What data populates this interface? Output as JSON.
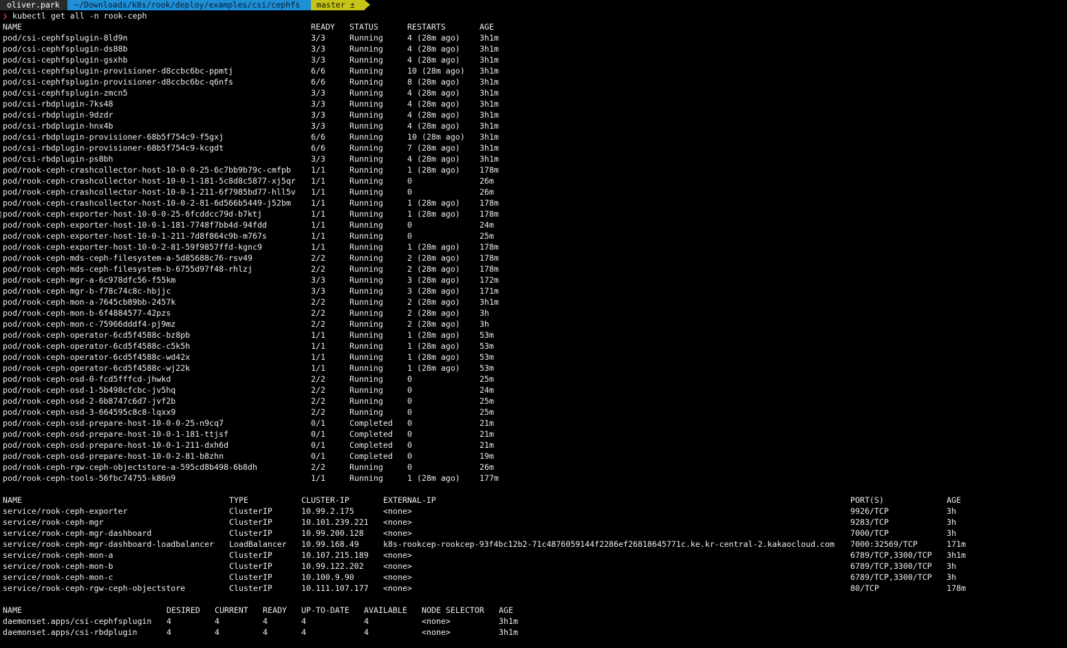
{
  "prompt": {
    "user": "oliver.park",
    "path": "~/Downloads/k8s/rook/deploy/examples/csi/cephfs",
    "git_branch": "master ±",
    "chevron": "❯",
    "command": "kubectl get all -n rook-ceph"
  },
  "pods": {
    "headers": [
      "NAME",
      "READY",
      "STATUS",
      "RESTARTS",
      "AGE"
    ],
    "rows": [
      [
        "pod/csi-cephfsplugin-8ld9n",
        "3/3",
        "Running",
        "4 (28m ago)",
        "3h1m"
      ],
      [
        "pod/csi-cephfsplugin-ds88b",
        "3/3",
        "Running",
        "4 (28m ago)",
        "3h1m"
      ],
      [
        "pod/csi-cephfsplugin-gsxhb",
        "3/3",
        "Running",
        "4 (28m ago)",
        "3h1m"
      ],
      [
        "pod/csi-cephfsplugin-provisioner-d8ccbc6bc-ppmtj",
        "6/6",
        "Running",
        "10 (28m ago)",
        "3h1m"
      ],
      [
        "pod/csi-cephfsplugin-provisioner-d8ccbc6bc-q6nfs",
        "6/6",
        "Running",
        "8 (28m ago)",
        "3h1m"
      ],
      [
        "pod/csi-cephfsplugin-zmcn5",
        "3/3",
        "Running",
        "4 (28m ago)",
        "3h1m"
      ],
      [
        "pod/csi-rbdplugin-7ks48",
        "3/3",
        "Running",
        "4 (28m ago)",
        "3h1m"
      ],
      [
        "pod/csi-rbdplugin-9dzdr",
        "3/3",
        "Running",
        "4 (28m ago)",
        "3h1m"
      ],
      [
        "pod/csi-rbdplugin-hnx4b",
        "3/3",
        "Running",
        "4 (28m ago)",
        "3h1m"
      ],
      [
        "pod/csi-rbdplugin-provisioner-68b5f754c9-f5gxj",
        "6/6",
        "Running",
        "10 (28m ago)",
        "3h1m"
      ],
      [
        "pod/csi-rbdplugin-provisioner-68b5f754c9-kcgdt",
        "6/6",
        "Running",
        "7 (28m ago)",
        "3h1m"
      ],
      [
        "pod/csi-rbdplugin-ps8bh",
        "3/3",
        "Running",
        "4 (28m ago)",
        "3h1m"
      ],
      [
        "pod/rook-ceph-crashcollector-host-10-0-0-25-6c7bb9b79c-cmfpb",
        "1/1",
        "Running",
        "1 (28m ago)",
        "178m"
      ],
      [
        "pod/rook-ceph-crashcollector-host-10-0-1-181-5c8d8c5877-xj5qr",
        "1/1",
        "Running",
        "0",
        "26m"
      ],
      [
        "pod/rook-ceph-crashcollector-host-10-0-1-211-6f7985bd77-hll5v",
        "1/1",
        "Running",
        "0",
        "26m"
      ],
      [
        "pod/rook-ceph-crashcollector-host-10-0-2-81-6d566b5449-j52bm",
        "1/1",
        "Running",
        "1 (28m ago)",
        "178m"
      ],
      [
        "pod/rook-ceph-exporter-host-10-0-0-25-6fcddcc79d-b7ktj",
        "1/1",
        "Running",
        "1 (28m ago)",
        "178m"
      ],
      [
        "pod/rook-ceph-exporter-host-10-0-1-181-7748f7bb4d-94fdd",
        "1/1",
        "Running",
        "0",
        "24m"
      ],
      [
        "pod/rook-ceph-exporter-host-10-0-1-211-7d8f864c9b-m767s",
        "1/1",
        "Running",
        "0",
        "25m"
      ],
      [
        "pod/rook-ceph-exporter-host-10-0-2-81-59f9857ffd-kgnc9",
        "1/1",
        "Running",
        "1 (28m ago)",
        "178m"
      ],
      [
        "pod/rook-ceph-mds-ceph-filesystem-a-5d85688c76-rsv49",
        "2/2",
        "Running",
        "2 (28m ago)",
        "178m"
      ],
      [
        "pod/rook-ceph-mds-ceph-filesystem-b-6755d97f48-rhlzj",
        "2/2",
        "Running",
        "2 (28m ago)",
        "178m"
      ],
      [
        "pod/rook-ceph-mgr-a-6c978dfc56-f55km",
        "3/3",
        "Running",
        "3 (28m ago)",
        "172m"
      ],
      [
        "pod/rook-ceph-mgr-b-f78c74c8c-hbjjc",
        "3/3",
        "Running",
        "3 (28m ago)",
        "171m"
      ],
      [
        "pod/rook-ceph-mon-a-7645cb89bb-2457k",
        "2/2",
        "Running",
        "2 (28m ago)",
        "3h1m"
      ],
      [
        "pod/rook-ceph-mon-b-6f4884577-42pzs",
        "2/2",
        "Running",
        "2 (28m ago)",
        "3h"
      ],
      [
        "pod/rook-ceph-mon-c-75966dddf4-pj9mz",
        "2/2",
        "Running",
        "2 (28m ago)",
        "3h"
      ],
      [
        "pod/rook-ceph-operator-6cd5f4588c-bz8pb",
        "1/1",
        "Running",
        "1 (28m ago)",
        "53m"
      ],
      [
        "pod/rook-ceph-operator-6cd5f4588c-c5k5h",
        "1/1",
        "Running",
        "1 (28m ago)",
        "53m"
      ],
      [
        "pod/rook-ceph-operator-6cd5f4588c-wd42x",
        "1/1",
        "Running",
        "1 (28m ago)",
        "53m"
      ],
      [
        "pod/rook-ceph-operator-6cd5f4588c-wj22k",
        "1/1",
        "Running",
        "1 (28m ago)",
        "53m"
      ],
      [
        "pod/rook-ceph-osd-0-fcd5fffcd-jhwkd",
        "2/2",
        "Running",
        "0",
        "25m"
      ],
      [
        "pod/rook-ceph-osd-1-5b498cfcbc-jv5hq",
        "2/2",
        "Running",
        "0",
        "24m"
      ],
      [
        "pod/rook-ceph-osd-2-6b8747c6d7-jvf2b",
        "2/2",
        "Running",
        "0",
        "25m"
      ],
      [
        "pod/rook-ceph-osd-3-664595c8c8-lqxx9",
        "2/2",
        "Running",
        "0",
        "25m"
      ],
      [
        "pod/rook-ceph-osd-prepare-host-10-0-0-25-n9cq7",
        "0/1",
        "Completed",
        "0",
        "21m"
      ],
      [
        "pod/rook-ceph-osd-prepare-host-10-0-1-181-ttjsf",
        "0/1",
        "Completed",
        "0",
        "21m"
      ],
      [
        "pod/rook-ceph-osd-prepare-host-10-0-1-211-dxh6d",
        "0/1",
        "Completed",
        "0",
        "21m"
      ],
      [
        "pod/rook-ceph-osd-prepare-host-10-0-2-81-b8zhn",
        "0/1",
        "Completed",
        "0",
        "19m"
      ],
      [
        "pod/rook-ceph-rgw-ceph-objectstore-a-595cd8b498-6b8dh",
        "2/2",
        "Running",
        "0",
        "26m"
      ],
      [
        "pod/rook-ceph-tools-56fbc74755-k86n9",
        "1/1",
        "Running",
        "1 (28m ago)",
        "177m"
      ]
    ]
  },
  "services": {
    "headers": [
      "NAME",
      "TYPE",
      "CLUSTER-IP",
      "EXTERNAL-IP",
      "PORT(S)",
      "AGE"
    ],
    "rows": [
      [
        "service/rook-ceph-exporter",
        "ClusterIP",
        "10.99.2.175",
        "<none>",
        "9926/TCP",
        "3h"
      ],
      [
        "service/rook-ceph-mgr",
        "ClusterIP",
        "10.101.239.221",
        "<none>",
        "9283/TCP",
        "3h"
      ],
      [
        "service/rook-ceph-mgr-dashboard",
        "ClusterIP",
        "10.99.200.128",
        "<none>",
        "7000/TCP",
        "3h"
      ],
      [
        "service/rook-ceph-mgr-dashboard-loadbalancer",
        "LoadBalancer",
        "10.99.168.49",
        "k8s-rookcep-rookcep-93f4bc12b2-71c4876059144f2286ef26818645771c.ke.kr-central-2.kakaocloud.com",
        "7000:32569/TCP",
        "171m"
      ],
      [
        "service/rook-ceph-mon-a",
        "ClusterIP",
        "10.107.215.189",
        "<none>",
        "6789/TCP,3300/TCP",
        "3h1m"
      ],
      [
        "service/rook-ceph-mon-b",
        "ClusterIP",
        "10.99.122.202",
        "<none>",
        "6789/TCP,3300/TCP",
        "3h"
      ],
      [
        "service/rook-ceph-mon-c",
        "ClusterIP",
        "10.100.9.90",
        "<none>",
        "6789/TCP,3300/TCP",
        "3h"
      ],
      [
        "service/rook-ceph-rgw-ceph-objectstore",
        "ClusterIP",
        "10.111.107.177",
        "<none>",
        "80/TCP",
        "178m"
      ]
    ]
  },
  "daemonsets": {
    "headers": [
      "NAME",
      "DESIRED",
      "CURRENT",
      "READY",
      "UP-TO-DATE",
      "AVAILABLE",
      "NODE SELECTOR",
      "AGE"
    ],
    "rows": [
      [
        "daemonset.apps/csi-cephfsplugin",
        "4",
        "4",
        "4",
        "4",
        "4",
        "<none>",
        "3h1m"
      ],
      [
        "daemonset.apps/csi-rbdplugin",
        "4",
        "4",
        "4",
        "4",
        "4",
        "<none>",
        "3h1m"
      ]
    ]
  }
}
